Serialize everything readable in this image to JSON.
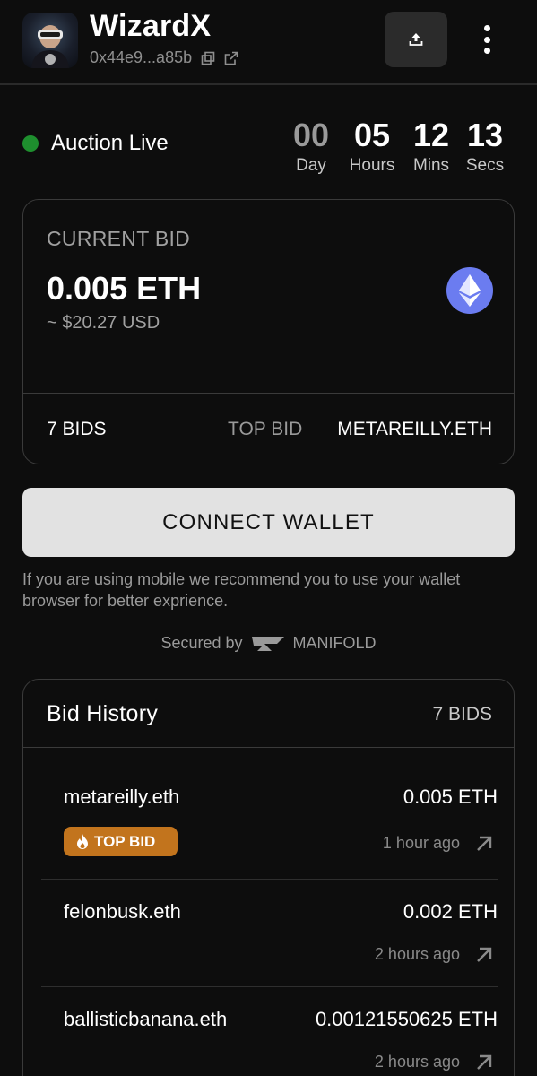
{
  "header": {
    "title": "WizardX",
    "address": "0x44e9...a85b",
    "icons": {
      "copy": "copy-icon",
      "external": "external-link-icon",
      "share": "share-upload-icon",
      "menu": "more-vertical-icon"
    }
  },
  "auction": {
    "status_label": "Auction Live",
    "status_color": "#1e8f2e",
    "countdown": [
      {
        "value": "00",
        "label": "Day",
        "dim": true
      },
      {
        "value": "05",
        "label": "Hours",
        "dim": false
      },
      {
        "value": "12",
        "label": "Mins",
        "dim": false
      },
      {
        "value": "13",
        "label": "Secs",
        "dim": false
      }
    ]
  },
  "current_bid": {
    "label": "CURRENT BID",
    "amount": "0.005 ETH",
    "usd": "~ $20.27 USD",
    "bids_count": "7 BIDS",
    "top_bid_label": "TOP BID",
    "top_bidder": "METAREILLY.ETH",
    "currency_icon": "ethereum-icon"
  },
  "connect": {
    "button_label": "CONNECT WALLET",
    "note": "If you are using mobile we recommend you to use your wallet browser for better exprience.",
    "secured_prefix": "Secured by",
    "secured_brand": "MANIFOLD"
  },
  "history": {
    "title": "Bid History",
    "count": "7 BIDS",
    "badge_label": "TOP BID",
    "rows": [
      {
        "name": "metareilly.eth",
        "amount": "0.005 ETH",
        "time": "1 hour ago",
        "top": true
      },
      {
        "name": "felonbusk.eth",
        "amount": "0.002 ETH",
        "time": "2 hours ago",
        "top": false
      },
      {
        "name": "ballisticbanana.eth",
        "amount": "0.00121550625 ETH",
        "time": "2 hours ago",
        "top": false
      }
    ]
  }
}
